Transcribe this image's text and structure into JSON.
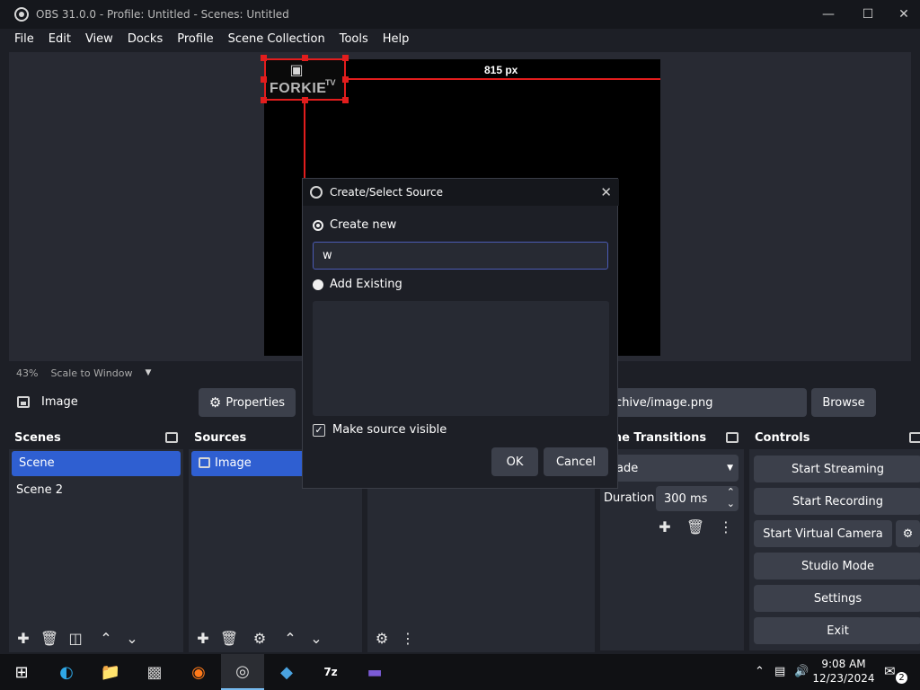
{
  "window": {
    "title": "OBS 31.0.0 - Profile: Untitled - Scenes: Untitled",
    "minimize": "—",
    "maximize": "☐",
    "close": "✕"
  },
  "menu": [
    "File",
    "Edit",
    "View",
    "Docks",
    "Profile",
    "Scene Collection",
    "Tools",
    "Help"
  ],
  "preview": {
    "logo_text": "FORKIE",
    "logo_tv": "TV",
    "guide_label": "815 px",
    "zoom_percent": "43%",
    "scale_mode": "Scale to Window"
  },
  "source_bar": {
    "name": "Image",
    "properties_label": "Properties",
    "path_fragment": "rchive/image.png",
    "browse_label": "Browse"
  },
  "scenes": {
    "title": "Scenes",
    "items": [
      "Scene",
      "Scene 2"
    ],
    "selected": 0
  },
  "sources": {
    "title": "Sources",
    "items": [
      "Image"
    ]
  },
  "transitions": {
    "title": "ene Transitions",
    "selected": "ade",
    "duration_label": "Duration",
    "duration_value": "300 ms"
  },
  "controls": {
    "title": "Controls",
    "start_streaming": "Start Streaming",
    "start_recording": "Start Recording",
    "start_virtual_camera": "Start Virtual Camera",
    "studio_mode": "Studio Mode",
    "settings": "Settings",
    "exit": "Exit"
  },
  "dialog": {
    "title": "Create/Select Source",
    "create_new_label": "Create new",
    "name_value": "w",
    "add_existing_label": "Add Existing",
    "make_visible_label": "Make source visible",
    "make_visible_checked": true,
    "ok_label": "OK",
    "cancel_label": "Cancel"
  },
  "taskbar": {
    "time": "9:08 AM",
    "date": "12/23/2024",
    "notification_count": "2"
  },
  "colors": {
    "selection": "#2f5fd1",
    "guide": "#e21d1d",
    "button": "#3c404b",
    "panel": "#272a33",
    "background": "#1d1f26"
  }
}
